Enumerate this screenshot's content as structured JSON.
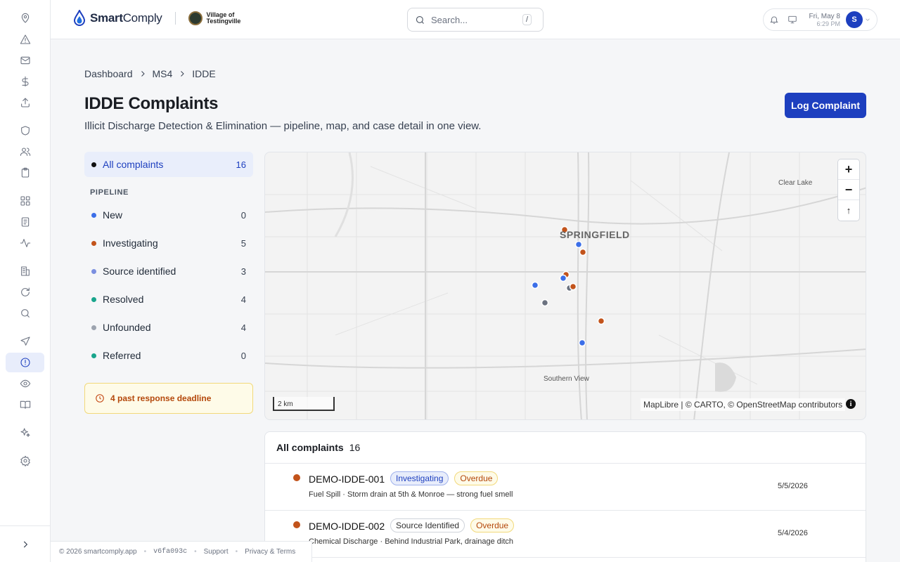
{
  "brand": {
    "name_bold": "Smart",
    "name_regular": "Comply",
    "village_line1": "Village of",
    "village_line2": "Testingville"
  },
  "search": {
    "placeholder": "Search...",
    "shortcut": "/"
  },
  "header": {
    "date": "Fri, May 8",
    "time": "6:29 PM",
    "avatar_initial": "S"
  },
  "breadcrumb": [
    "Dashboard",
    "MS4",
    "IDDE"
  ],
  "page": {
    "title": "IDDE Complaints",
    "subtitle": "Illicit Discharge Detection & Elimination — pipeline, map, and case detail in one view.",
    "log_button": "Log Complaint"
  },
  "pipeline": {
    "all": {
      "label": "All complaints",
      "count": "16",
      "color": "#111111"
    },
    "heading": "PIPELINE",
    "stages": [
      {
        "label": "New",
        "count": "0",
        "color": "#3b6ee8"
      },
      {
        "label": "Investigating",
        "count": "5",
        "color": "#c2531b"
      },
      {
        "label": "Source identified",
        "count": "3",
        "color": "#7b8fe0"
      },
      {
        "label": "Resolved",
        "count": "4",
        "color": "#19a58c"
      },
      {
        "label": "Unfounded",
        "count": "4",
        "color": "#9ca3af"
      },
      {
        "label": "Referred",
        "count": "0",
        "color": "#19a58c"
      }
    ],
    "deadline": "4 past response deadline"
  },
  "map": {
    "city": "SPRINGFIELD",
    "labels": [
      "Clear Lake",
      "Southern View"
    ],
    "zoom_in": "+",
    "zoom_out": "−",
    "compass": "↑",
    "scale": "2 km",
    "attribution": "MapLibre | © CARTO, © OpenStreetMap contributors",
    "info": "i"
  },
  "complaints": {
    "title": "All complaints",
    "count": "16",
    "rows": [
      {
        "id": "DEMO-IDDE-001",
        "status": "Investigating",
        "flag": "Overdue",
        "desc": "Fuel Spill · Storm drain at 5th & Monroe — strong fuel smell",
        "date": "5/5/2026",
        "color": "#c2531b"
      },
      {
        "id": "DEMO-IDDE-002",
        "status": "Source Identified",
        "flag": "Overdue",
        "desc": "Chemical Discharge · Behind Industrial Park, drainage ditch",
        "date": "5/4/2026",
        "color": "#c2531b"
      }
    ]
  },
  "footer": {
    "copyright": "© 2026 smartcomply.app",
    "version": "v6fa093c",
    "support": "Support",
    "privacy": "Privacy & Terms"
  }
}
